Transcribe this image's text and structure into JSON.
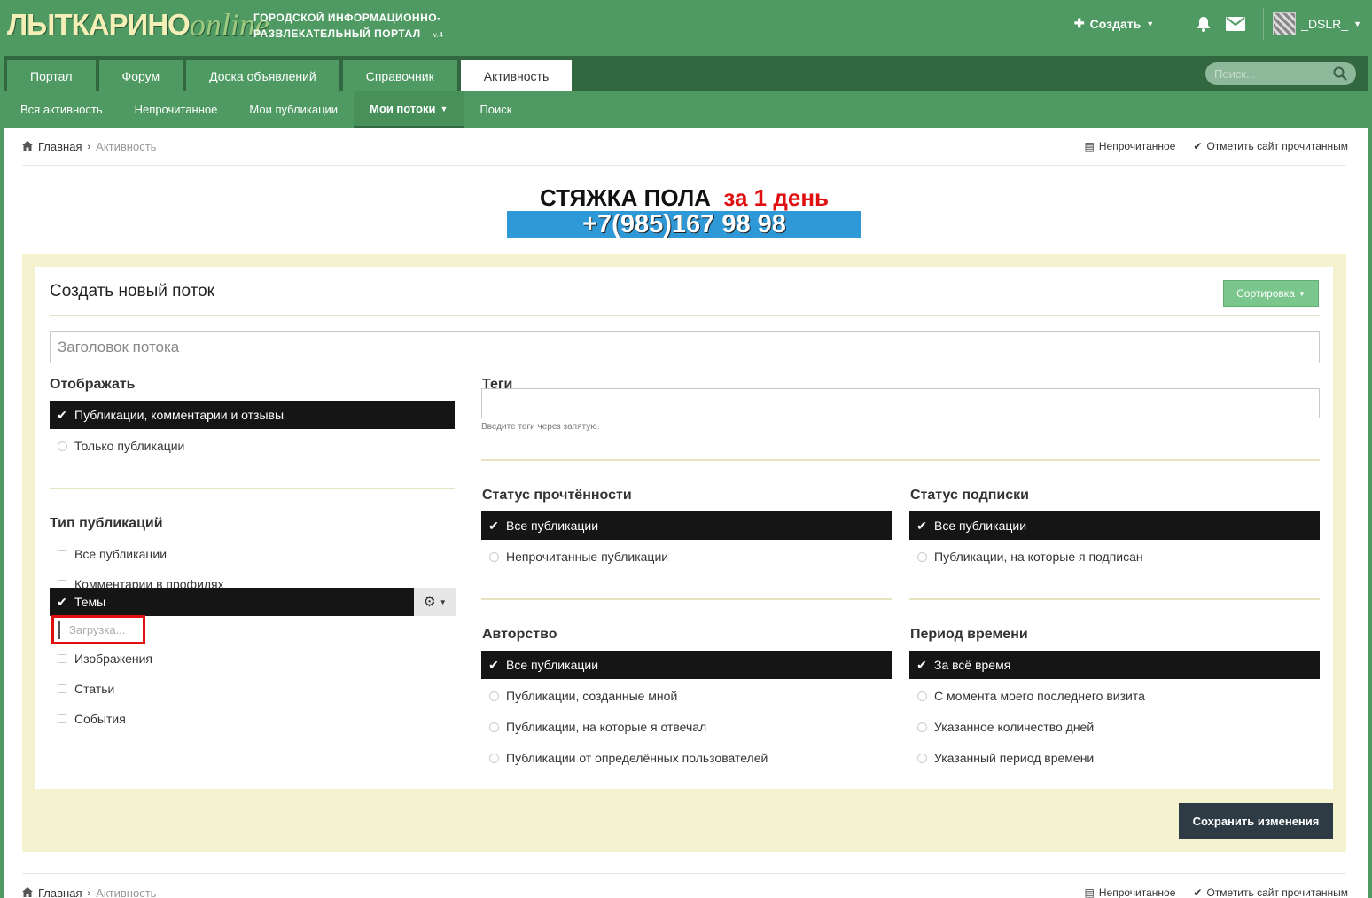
{
  "logo": {
    "main": "ЛЫТКАРИНО",
    "suffix": "online"
  },
  "tagline": {
    "line1": "ГОРОДСКОЙ ИНФОРМАЦИОННО-",
    "line2": "РАЗВЛЕКАТЕЛЬНЫЙ ПОРТАЛ",
    "version": "v.4"
  },
  "header": {
    "create_label": "Создать",
    "username": "_DSLR_"
  },
  "nav": {
    "tabs": [
      "Портал",
      "Форум",
      "Доска объявлений",
      "Справочник",
      "Активность"
    ],
    "active_tab": "Активность",
    "search_placeholder": "Поиск..."
  },
  "subnav": [
    "Вся активность",
    "Непрочитанное",
    "Мои публикации",
    "Мои потоки",
    "Поиск"
  ],
  "breadcrumb": {
    "home": "Главная",
    "current": "Активность"
  },
  "breadcrumb_actions": {
    "unread": "Непрочитанное",
    "mark_read": "Отметить сайт прочитанным"
  },
  "ad": {
    "line1": "СТЯЖКА ПОЛА",
    "line1_red": "за 1 день",
    "phone": "+7(985)167 98 98"
  },
  "form": {
    "title": "Создать новый поток",
    "sort_label": "Сортировка",
    "title_placeholder": "Заголовок потока",
    "display": {
      "heading": "Отображать",
      "options": [
        "Публикации, комментарии и отзывы",
        "Только публикации"
      ],
      "selected": 0
    },
    "content_type": {
      "heading": "Тип публикаций",
      "options": [
        "Все публикации",
        "Комментарии в профилях",
        "Темы",
        "Изображения",
        "Статьи",
        "События"
      ],
      "selected": 2,
      "loading_text": "Загрузка..."
    },
    "tags": {
      "heading": "Теги",
      "value": "",
      "hint": "Введите теги через запятую."
    },
    "read_status": {
      "heading": "Статус прочтённости",
      "options": [
        "Все публикации",
        "Непрочитанные публикации"
      ],
      "selected": 0
    },
    "follow_status": {
      "heading": "Статус подписки",
      "options": [
        "Все публикации",
        "Публикации, на которые я подписан"
      ],
      "selected": 0
    },
    "ownership": {
      "heading": "Авторство",
      "options": [
        "Все публикации",
        "Публикации, созданные мной",
        "Публикации, на которые я отвечал",
        "Публикации от определённых пользователей"
      ],
      "selected": 0
    },
    "date_range": {
      "heading": "Период времени",
      "options": [
        "За всё время",
        "С момента моего последнего визита",
        "Указанное количество дней",
        "Указанный период времени"
      ],
      "selected": 0
    },
    "save_label": "Сохранить изменения"
  },
  "colors": {
    "header_green": "#4e9a62",
    "nav_dark": "#32683f",
    "panel": "#f5f2d0",
    "sort_btn": "#7ac68d",
    "save_btn": "#2f3b44",
    "selected_row": "#151515",
    "highlight_box": "#e01010",
    "ad_blue": "#2f99d8"
  }
}
